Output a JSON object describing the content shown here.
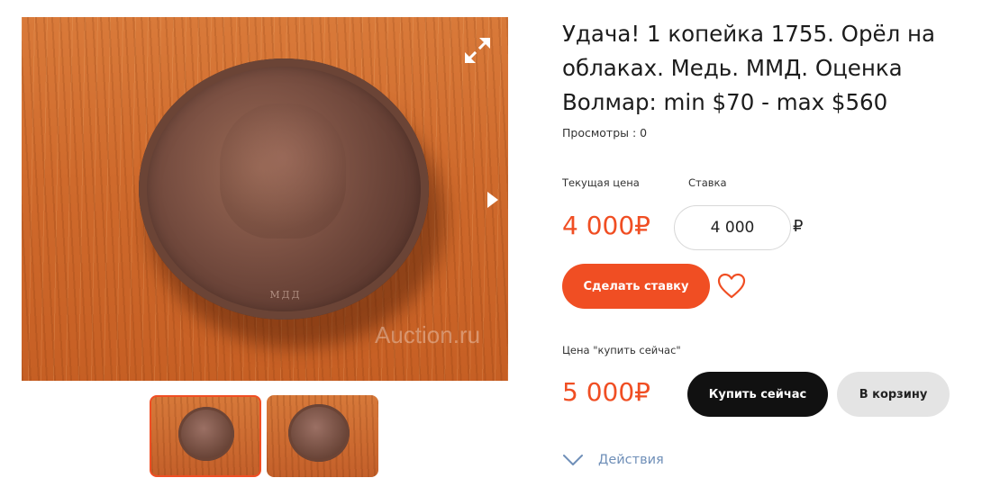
{
  "lot": {
    "title": "Удача! 1 копейка 1755. Орёл на облаках. Медь. ММД. Оценка Волмар: min $70 - max $560",
    "views_label": "Просмотры : 0"
  },
  "gallery": {
    "watermark": "Auction.ru",
    "coin_legend": "МДД",
    "thumbnails": [
      {
        "selected": true
      },
      {
        "selected": false
      }
    ],
    "icons": {
      "expand": "expand-arrows-icon",
      "next": "play-next-icon"
    }
  },
  "bidding": {
    "current_price_label": "Текущая цена",
    "bid_label": "Ставка",
    "current_price": "4 000₽",
    "bid_value": "4 000",
    "bid_currency": "₽",
    "place_bid_button": "Сделать ставку",
    "favorite_icon": "heart-icon"
  },
  "buy_now": {
    "label": "Цена \"купить сейчас\"",
    "price": "5 000₽",
    "buy_button": "Купить сейчас",
    "cart_button": "В корзину"
  },
  "actions": {
    "label": "Действия",
    "icon": "chevron-down-icon"
  },
  "colors": {
    "accent": "#f04e23",
    "dark_button": "#111111",
    "light_button": "#e4e4e4",
    "link": "#6f8fb8"
  }
}
